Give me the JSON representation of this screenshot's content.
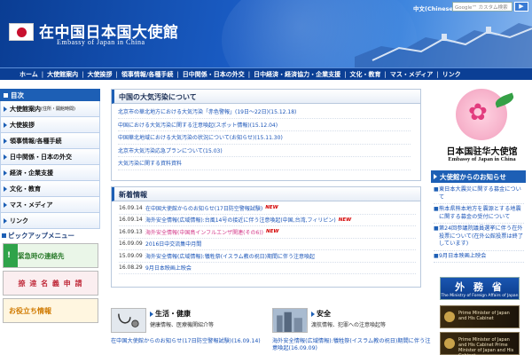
{
  "header": {
    "title": "在中国日本国大使館",
    "subtitle": "Embassy of Japan in China",
    "lang_link": "中文(Chinese)",
    "search_placeholder": "Google™ カスタム検索",
    "search_button": "▶"
  },
  "nav": {
    "items": [
      "ホーム",
      "大使館案内",
      "大使挨拶",
      "領事情報/各種手続",
      "日中関係・日本の外交",
      "日中経済・経済協力・企業支援",
      "文化・教育",
      "マス・メディア",
      "リンク"
    ]
  },
  "sidebar": {
    "heading": "目次",
    "items": [
      {
        "label": "大使館案内",
        "note": "(住所・開館時間)"
      },
      {
        "label": "大使挨拶",
        "note": ""
      },
      {
        "label": "領事情報/各種手続",
        "note": ""
      },
      {
        "label": "日中関係・日本の外交",
        "note": ""
      },
      {
        "label": "経済・企業支援",
        "note": ""
      },
      {
        "label": "文化・教育",
        "note": ""
      },
      {
        "label": "マス・メディア",
        "note": ""
      },
      {
        "label": "リンク",
        "note": ""
      }
    ],
    "pickup_heading": "ピックアップメニュー",
    "banners": [
      "緊急時の連絡先",
      "捺 逹 名 義 申 請",
      "お役立ち情報"
    ]
  },
  "air_pollution": {
    "title": "中国の大気汚染について",
    "items": [
      {
        "text": "北京市の華北地方における大気汚染「赤色警報」(19日～22日)(15.12.18)",
        "red": false
      },
      {
        "text": "中国における大気汚染に関する注意喚起(スポット情報)(15.12.04)",
        "red": false
      },
      {
        "text": "中国華北地域における大気汚染の状況について(お知らせ)(15.11.30)",
        "red": false
      },
      {
        "text": "北京市大気汚染応急プランについて(15.03)",
        "red": false
      },
      {
        "text": "大気汚染に関する資料資料",
        "red": false
      }
    ]
  },
  "news": {
    "title": "新着情報",
    "new_label": "NEW",
    "items": [
      {
        "date": "16.09.14",
        "text": "在中国大使館からのお知らせ(17日防空警報試験)",
        "new": true,
        "pink": false
      },
      {
        "date": "16.09.14",
        "text": "海外安全情報(広域情報):台風14号の接近に伴う注意喚起(中国,台湾,フィリピン)",
        "new": true,
        "pink": false
      },
      {
        "date": "16.09.13",
        "text": "海外安全情報(中国鳥インフルエンザ関連(その6))",
        "new": true,
        "pink": true
      },
      {
        "date": "16.09.09",
        "text": "2016日中交流集中月間",
        "new": false,
        "pink": false
      },
      {
        "date": "15.09.09",
        "text": "海外安全情報(広域情報):犠牲祭(イスラム教の祝日)期間に伴う注意喚起",
        "new": false,
        "pink": false
      },
      {
        "date": "16.08.29",
        "text": "9月日本映画上映会",
        "new": false,
        "pink": false
      }
    ]
  },
  "features": {
    "life": {
      "title": "生活・健康",
      "sub": "健康情報、医療機関紹介等",
      "link": "在中国大使館からのお知らせ(17日防空警報試験)(16.09.14)"
    },
    "safety": {
      "title": "安全",
      "sub": "渡航情報、犯罪への注意喚起等",
      "link": "海外安全情報(広域情報):犠牲祭(イスラム教の祝日)期間に伴う注意喚起(16.09.09)"
    }
  },
  "emblem": {
    "name": "日本国驻华大使馆",
    "name_en": "Embassy of Japan in China"
  },
  "notices": {
    "heading": "大使館からのお知らせ",
    "items": [
      "東日本大震災に関する募金について",
      "熊本県熊本地方を震源とする地震に関する募金の受付について",
      "第24回参議院議員選挙に伴う在外投票について(在外公館投票は終了しています)",
      "9月日本映画上映会"
    ]
  },
  "right_banners": {
    "mofa_jp": "外 務 省",
    "mofa_en": "The Ministry of Foreign Affairs of Japan",
    "pm1": "Prime Minister of Japan and His Cabinet",
    "pm2": "Prime Minister of Japan and His Cabinet Prime Minister of Japan and His Cabinet"
  }
}
